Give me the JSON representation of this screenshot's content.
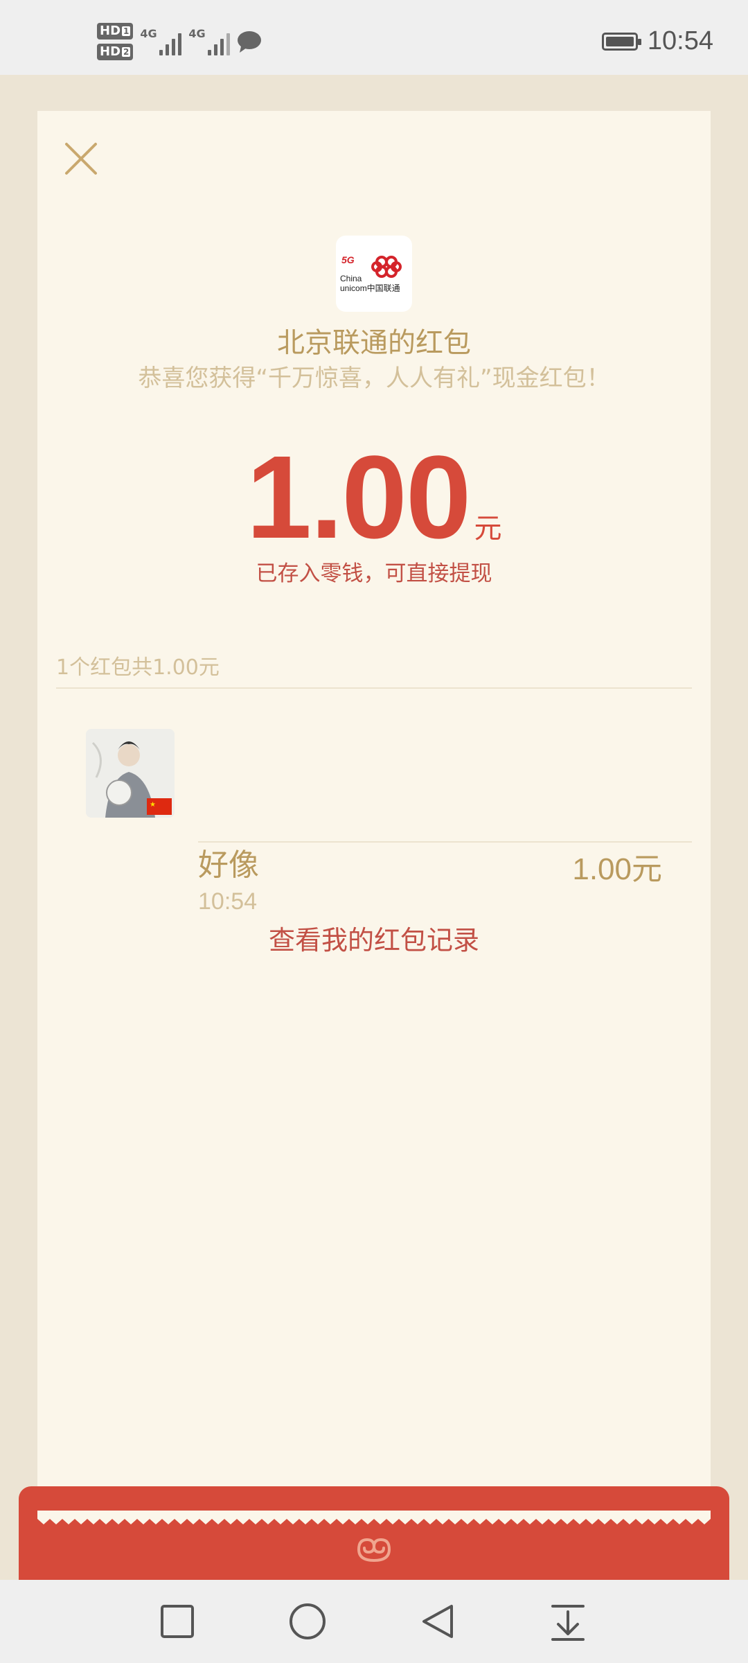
{
  "status_bar": {
    "time": "10:54",
    "sim1_label": "HD",
    "sim1_index": "1",
    "sim2_label": "HD",
    "sim2_index": "2",
    "network1": "4G",
    "network2": "4G",
    "icons": [
      "signal-icon",
      "signal-icon",
      "message-icon",
      "battery-icon"
    ]
  },
  "packet": {
    "logo_text_5g": "5G",
    "logo_text_brand": "China unicom中国联通",
    "title": "北京联通的红包",
    "subtitle": "恭喜您获得“千万惊喜，人人有礼”现金红包！",
    "amount": "1.00",
    "currency": "元",
    "stored_note": "已存入零钱，可直接提现",
    "summary": "1个红包共1.00元",
    "records_link": "查看我的红包记录"
  },
  "recipients": [
    {
      "name": "好像",
      "time": "10:54",
      "amount": "1.00元"
    }
  ],
  "colors": {
    "accent_red": "#d64a3a",
    "gold_text": "#b99a5e",
    "light_gold": "#d3c09a",
    "card_bg": "#fbf6ea",
    "page_bg": "#ece4d4"
  },
  "nav": [
    "recent-apps-button",
    "home-button",
    "back-button",
    "notification-button"
  ]
}
